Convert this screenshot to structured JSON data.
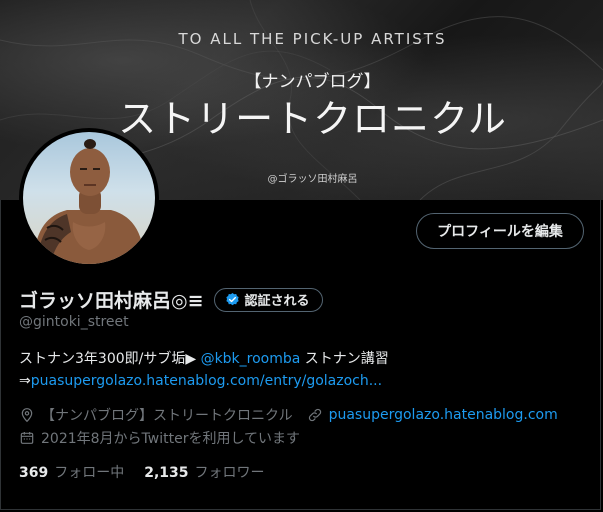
{
  "banner": {
    "top_text": "TO ALL THE PICK-UP ARTISTS",
    "sub_text": "【ナンパブログ】",
    "main_text": "ストリートクロニクル",
    "handle_text": "@ゴラッソ田村麻呂"
  },
  "profile": {
    "name": "ゴラッソ田村麻呂◎≡",
    "handle": "@gintoki_street",
    "edit_button": "プロフィールを編集",
    "verify_button": "認証される",
    "bio_line1_prefix": "ストナン3年300即/サブ垢▶ ",
    "bio_line1_mention": "@kbk_roomba",
    "bio_line1_suffix": " ストナン講習",
    "bio_line2_arrow": "⇒",
    "bio_line2_link": "puasupergolazo.hatenablog.com/entry/golazoch...",
    "location": "【ナンパブログ】ストリートクロニクル",
    "website": "puasupergolazo.hatenablog.com",
    "joined": "2021年8月からTwitterを利用しています",
    "following_count": "369",
    "following_label": "フォロー中",
    "followers_count": "2,135",
    "followers_label": "フォロワー"
  },
  "colors": {
    "accent": "#1d9bf0",
    "muted": "#71767b",
    "text": "#e7e9ea",
    "background": "#000000",
    "border": "#536471"
  },
  "icons": {
    "location": "location-pin-icon",
    "link": "link-icon",
    "calendar": "calendar-icon",
    "verified": "verified-badge-icon"
  }
}
